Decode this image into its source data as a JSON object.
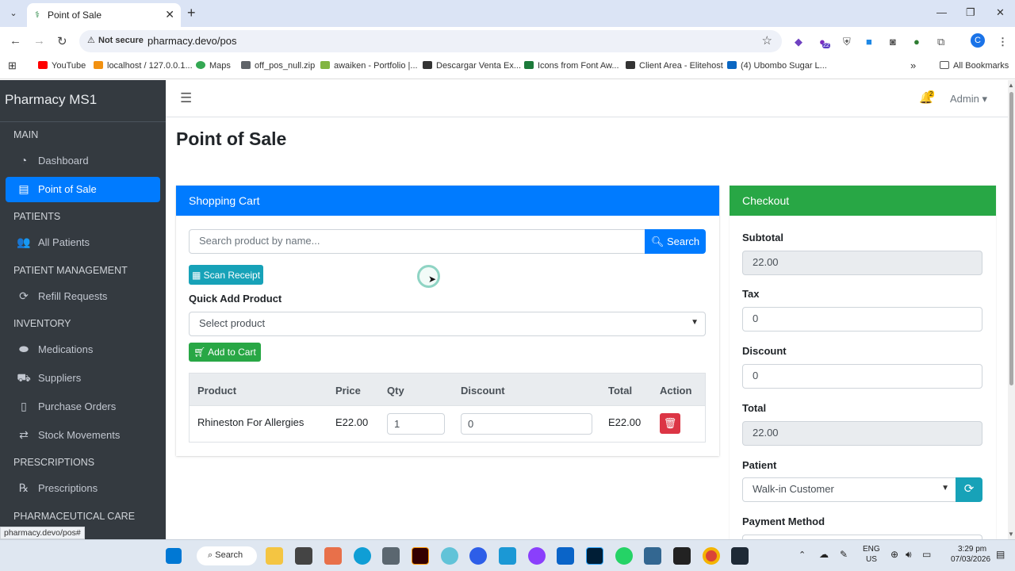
{
  "browser": {
    "tab_title": "Point of Sale",
    "security_label": "Not secure",
    "url": "pharmacy.devo/pos",
    "profile_initial": "C",
    "extension_badge": "22",
    "bookmarks": [
      {
        "label": "YouTube",
        "icon": "youtube-icon",
        "color": "#ff0000"
      },
      {
        "label": "localhost / 127.0.0.1...",
        "icon": "phpmyadmin-icon",
        "color": "#f29111"
      },
      {
        "label": "Maps",
        "icon": "maps-icon",
        "color": "#34a853"
      },
      {
        "label": "off_pos_null.zip",
        "icon": "link-icon",
        "color": "#5f6368"
      },
      {
        "label": "awaiken - Portfolio |...",
        "icon": "envato-icon",
        "color": "#82b541"
      },
      {
        "label": "Descargar Venta Ex...",
        "icon": "site-icon",
        "color": "#333333"
      },
      {
        "label": "Icons from Font Aw...",
        "icon": "fontawesome-icon",
        "color": "#1c7a3a"
      },
      {
        "label": "Client Area - Elitehost",
        "icon": "elitehost-icon",
        "color": "#333333"
      },
      {
        "label": "(4) Ubombo Sugar L...",
        "icon": "linkedin-icon",
        "color": "#0a66c2"
      }
    ],
    "all_bookmarks": "All Bookmarks"
  },
  "sidebar": {
    "brand": "Pharmacy MS1",
    "sections": [
      {
        "header": "MAIN",
        "items": [
          {
            "label": "Dashboard",
            "icon": "dashboard-icon",
            "active": false
          },
          {
            "label": "Point of Sale",
            "icon": "cash-register-icon",
            "active": true
          }
        ]
      },
      {
        "header": "PATIENTS",
        "items": [
          {
            "label": "All Patients",
            "icon": "users-icon",
            "active": false
          }
        ]
      },
      {
        "header": "PATIENT MANAGEMENT",
        "items": [
          {
            "label": "Refill Requests",
            "icon": "sync-icon",
            "active": false
          }
        ]
      },
      {
        "header": "INVENTORY",
        "items": [
          {
            "label": "Medications",
            "icon": "pills-icon",
            "active": false
          },
          {
            "label": "Suppliers",
            "icon": "truck-icon",
            "active": false
          },
          {
            "label": "Purchase Orders",
            "icon": "clipboard-icon",
            "active": false
          },
          {
            "label": "Stock Movements",
            "icon": "exchange-icon",
            "active": false
          }
        ]
      },
      {
        "header": "PRESCRIPTIONS",
        "items": [
          {
            "label": "Prescriptions",
            "icon": "prescription-icon",
            "active": false
          }
        ]
      },
      {
        "header": "PHARMACEUTICAL CARE",
        "items": []
      }
    ]
  },
  "topnav": {
    "notification_count": "2",
    "user": "Admin"
  },
  "page": {
    "title": "Point of Sale"
  },
  "cart": {
    "header": "Shopping Cart",
    "search_placeholder": "Search product by name...",
    "search_button": "Search",
    "scan_button": "Scan Receipt",
    "quick_add_label": "Quick Add Product",
    "select_placeholder": "Select product",
    "add_button": "Add to Cart",
    "columns": [
      "Product",
      "Price",
      "Qty",
      "Discount",
      "Total",
      "Action"
    ],
    "rows": [
      {
        "product": "Rhineston For Allergies",
        "price": "E22.00",
        "qty": "1",
        "discount": "0",
        "total": "E22.00"
      }
    ]
  },
  "checkout": {
    "header": "Checkout",
    "subtotal_label": "Subtotal",
    "subtotal": "22.00",
    "tax_label": "Tax",
    "tax": "0",
    "discount_label": "Discount",
    "discount": "0",
    "total_label": "Total",
    "total": "22.00",
    "patient_label": "Patient",
    "patient": "Walk-in Customer",
    "payment_label": "Payment Method"
  },
  "status_url": "pharmacy.devo/pos#",
  "taskbar": {
    "search": "Search",
    "lang": "ENG",
    "region": "US",
    "time": "3:29 pm",
    "date": "07/03/2026"
  },
  "colors": {
    "primary": "#007bff",
    "success": "#28a745",
    "info": "#17a2b8",
    "danger": "#dc3545",
    "sidebar": "#343a40"
  }
}
